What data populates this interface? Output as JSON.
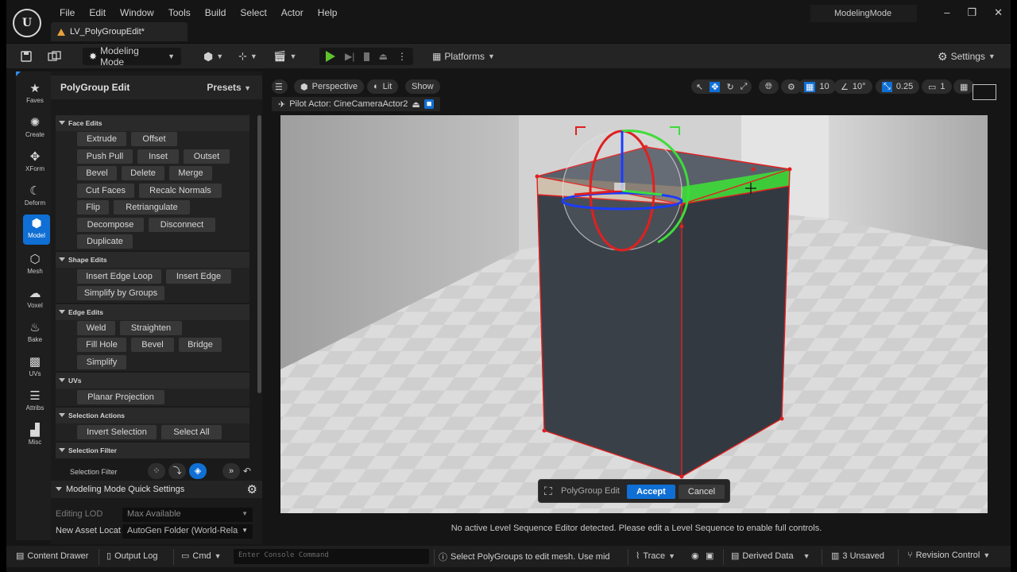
{
  "app": {
    "menus": [
      "File",
      "Edit",
      "Window",
      "Tools",
      "Build",
      "Select",
      "Actor",
      "Help"
    ],
    "level_tab": "LV_PolyGroupEdit*",
    "mode_title": "ModelingMode",
    "window_buttons": [
      "minimize-icon",
      "restore-icon",
      "close-icon"
    ]
  },
  "toolbar": {
    "mode_select": "Modeling Mode",
    "platforms": "Platforms",
    "settings": "Settings"
  },
  "icon_strip": [
    {
      "label": "Faves",
      "icon": "star-icon"
    },
    {
      "label": "Create",
      "icon": "create-icon"
    },
    {
      "label": "XForm",
      "icon": "xform-icon"
    },
    {
      "label": "Deform",
      "icon": "deform-icon"
    },
    {
      "label": "Model",
      "icon": "model-icon",
      "active": true
    },
    {
      "label": "Mesh",
      "icon": "mesh-icon"
    },
    {
      "label": "Voxel",
      "icon": "voxel-icon"
    },
    {
      "label": "Bake",
      "icon": "bake-icon"
    },
    {
      "label": "UVs",
      "icon": "uvs-icon"
    },
    {
      "label": "Attribs",
      "icon": "attribs-icon"
    },
    {
      "label": "Misc",
      "icon": "misc-icon"
    }
  ],
  "panel": {
    "title": "PolyGroup Edit",
    "presets": "Presets",
    "sections": {
      "face_edits": "Face Edits",
      "shape_edits": "Shape Edits",
      "edge_edits": "Edge Edits",
      "uvs": "UVs",
      "selection_actions": "Selection Actions",
      "selection_filter": "Selection Filter"
    },
    "buttons": {
      "extrude": "Extrude",
      "offset": "Offset",
      "push_pull": "Push Pull",
      "inset": "Inset",
      "outset": "Outset",
      "bevel": "Bevel",
      "delete": "Delete",
      "merge": "Merge",
      "cut_faces": "Cut Faces",
      "recalc_normals": "Recalc Normals",
      "flip": "Flip",
      "retriangulate": "Retriangulate",
      "decompose": "Decompose",
      "disconnect": "Disconnect",
      "duplicate": "Duplicate",
      "insert_edge_loop": "Insert Edge Loop",
      "insert_edge": "Insert Edge",
      "simplify_by_groups": "Simplify by Groups",
      "weld": "Weld",
      "straighten": "Straighten",
      "fill_hole": "Fill Hole",
      "edge_bevel": "Bevel",
      "bridge": "Bridge",
      "simplify": "Simplify",
      "planar_projection": "Planar Projection",
      "invert_selection": "Invert Selection",
      "select_all": "Select All"
    },
    "selection_filter_label": "Selection Filter"
  },
  "quick_settings": {
    "title": "Modeling Mode Quick Settings",
    "editing_lod_label": "Editing LOD",
    "editing_lod_value": "Max Available",
    "new_asset_label": "New Asset Locat",
    "new_asset_value": "AutoGen Folder (World-Rela"
  },
  "viewport": {
    "perspective": "Perspective",
    "lit": "Lit",
    "show": "Show",
    "pilot": "Pilot Actor: CineCameraActor2",
    "grid_snap": "10",
    "rot_snap": "10°",
    "scale_snap": "0.25",
    "camera_speed": "1"
  },
  "accept_bar": {
    "label": "PolyGroup Edit",
    "accept": "Accept",
    "cancel": "Cancel"
  },
  "sequence_message": "No active Level Sequence Editor detected. Please edit a Level Sequence to enable full controls.",
  "statusbar": {
    "content_drawer": "Content Drawer",
    "output_log": "Output Log",
    "cmd": "Cmd",
    "console_placeholder": "Enter Console Command",
    "hint": "Select PolyGroups to edit mesh. Use mid",
    "trace": "Trace",
    "derived_data": "Derived Data",
    "unsaved": "3 Unsaved",
    "revision_control": "Revision Control"
  },
  "colors": {
    "accent": "#0f6fd4",
    "play_green": "#5fc12e",
    "selection_red": "#e02020",
    "selected_face_green": "#3fdc3a",
    "warning_orange": "#e8a13a"
  }
}
